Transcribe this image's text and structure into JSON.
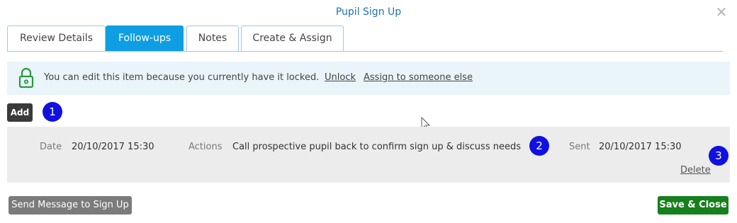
{
  "dialog": {
    "title": "Pupil Sign Up",
    "close_icon": "close-icon"
  },
  "tabs": [
    {
      "label": "Review Details",
      "active": false
    },
    {
      "label": "Follow-ups",
      "active": true
    },
    {
      "label": "Notes",
      "active": false
    },
    {
      "label": "Create & Assign",
      "active": false
    }
  ],
  "banner": {
    "icon": "lock-icon",
    "message": "You can edit this item because you currently have it locked.",
    "unlock_label": "Unlock",
    "assign_label": "Assign to someone else"
  },
  "toolbar": {
    "add_label": "Add"
  },
  "markers": [
    "1",
    "2",
    "3"
  ],
  "followups": [
    {
      "date_label": "Date",
      "date": "20/10/2017 15:30",
      "actions_label": "Actions",
      "actions": "Call prospective pupil back to confirm sign up & discuss needs",
      "sent_label": "Sent",
      "sent": "20/10/2017 15:30",
      "delete_label": "Delete"
    }
  ],
  "footer": {
    "send_label": "Send Message to Sign Up",
    "save_label": "Save & Close"
  },
  "colors": {
    "accent": "#0f9ee3",
    "title": "#1f6fb5",
    "save": "#16801d",
    "marker": "#1010e0"
  }
}
